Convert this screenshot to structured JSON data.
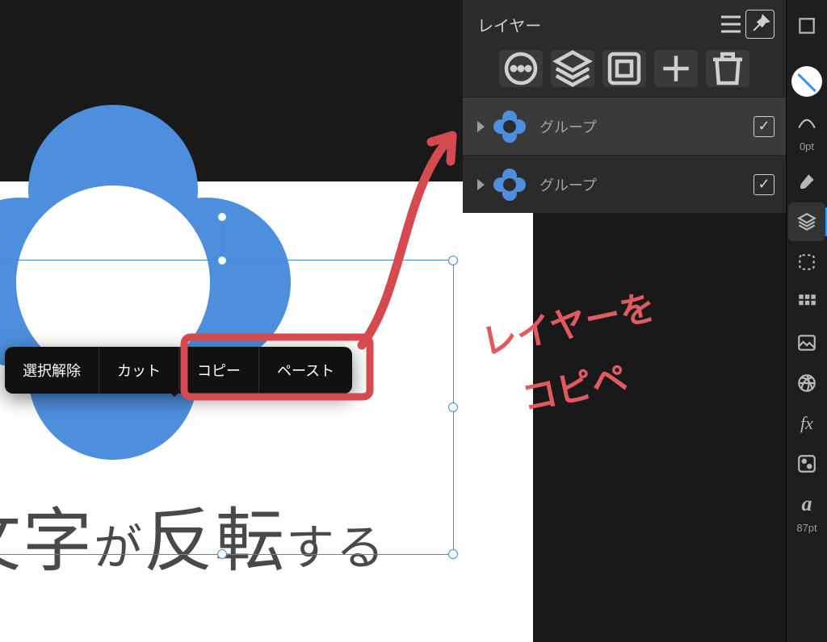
{
  "canvas": {
    "text_main": "文字",
    "text_ga": "が",
    "text_rev": "反転",
    "text_suru": "する"
  },
  "context_menu": {
    "deselect": "選択解除",
    "cut": "カット",
    "copy": "コピー",
    "paste": "ペースト"
  },
  "annotation": {
    "line1": "レイヤーを",
    "line2": "コピペ"
  },
  "layers_panel": {
    "title": "レイヤー",
    "items": [
      {
        "name": "グループ",
        "selected": true,
        "checked": true
      },
      {
        "name": "グループ",
        "selected": false,
        "checked": true
      }
    ]
  },
  "sidebar": {
    "stroke_label": "0pt",
    "text_size_label": "87pt"
  }
}
